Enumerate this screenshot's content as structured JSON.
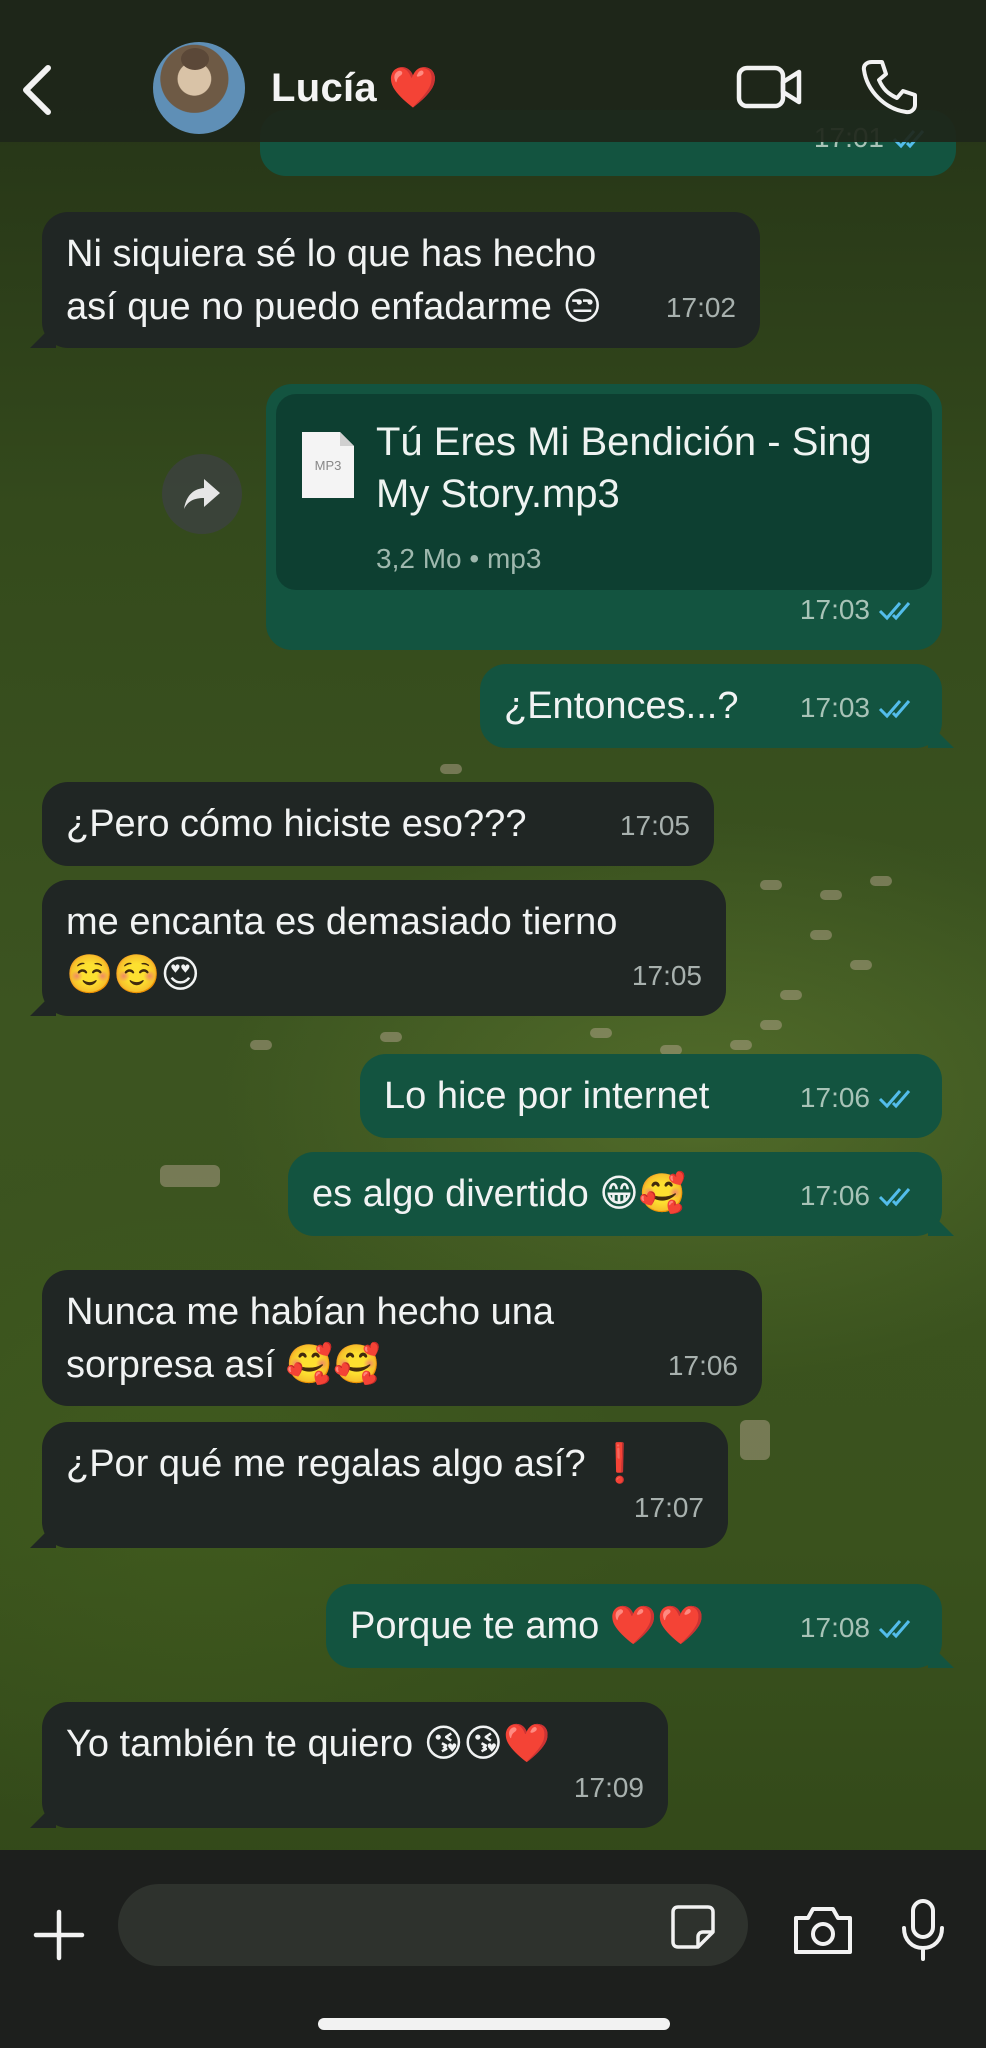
{
  "header": {
    "contact_name": "Lucía ❤️"
  },
  "messages": [
    {
      "id": "m0",
      "direction": "out",
      "text": "",
      "time": "17:01",
      "read": true
    },
    {
      "id": "m1",
      "direction": "in",
      "text": "Ni siquiera sé lo que has hecho así que no puedo enfadarme 😒",
      "time": "17:02"
    },
    {
      "id": "m2",
      "direction": "out",
      "type": "file",
      "file_icon_label": "MP3",
      "file_name": "Tú Eres Mi Bendición - Sing My Story.mp3",
      "file_meta": "3,2 Mo • mp3",
      "time": "17:03",
      "read": true
    },
    {
      "id": "m3",
      "direction": "out",
      "text": "¿Entonces...?",
      "time": "17:03",
      "read": true
    },
    {
      "id": "m4",
      "direction": "in",
      "text": "¿Pero cómo hiciste eso???",
      "time": "17:05"
    },
    {
      "id": "m5",
      "direction": "in",
      "text": "me encanta es demasiado tierno ☺️☺️😍",
      "time": "17:05"
    },
    {
      "id": "m6",
      "direction": "out",
      "text": "Lo hice por internet",
      "time": "17:06",
      "read": true
    },
    {
      "id": "m7",
      "direction": "out",
      "text": "es algo divertido 😁🥰",
      "time": "17:06",
      "read": true
    },
    {
      "id": "m8",
      "direction": "in",
      "text": "Nunca me habían hecho una sorpresa así 🥰🥰",
      "time": "17:06"
    },
    {
      "id": "m9",
      "direction": "in",
      "text": "¿Por qué me regalas algo así? ❗️",
      "time": "17:07"
    },
    {
      "id": "m10",
      "direction": "out",
      "text": "Porque te amo ❤️❤️",
      "time": "17:08",
      "read": true
    },
    {
      "id": "m11",
      "direction": "in",
      "text": "Yo también te quiero 😘😘❤️",
      "time": "17:09"
    }
  ],
  "composer": {
    "value": "",
    "placeholder": ""
  },
  "colors": {
    "incoming_bubble": "#202624",
    "outgoing_bubble": "#135440",
    "read_ticks": "#53bdeb"
  },
  "icons": [
    "back-chevron-icon",
    "video-call-icon",
    "phone-icon",
    "forward-icon",
    "document-icon",
    "plus-icon",
    "sticker-icon",
    "camera-icon",
    "microphone-icon"
  ]
}
